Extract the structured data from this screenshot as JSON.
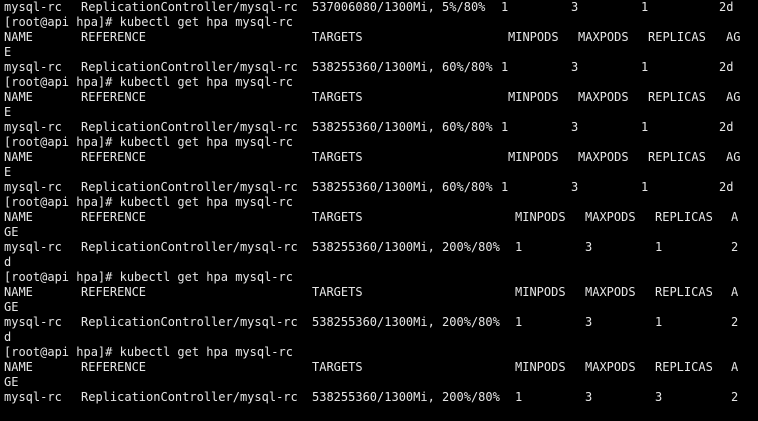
{
  "terminal": {
    "background": "#000000",
    "foreground": "#e6e6e6",
    "lines": [
      {
        "kind": "row",
        "cells": [
          "mysql-rc",
          "ReplicationController/mysql-rc",
          "537006080/1300Mi, 5%/80%",
          "1",
          "3",
          "1",
          "2d"
        ]
      },
      {
        "kind": "text",
        "text": "[root@api hpa]# kubectl get hpa mysql-rc"
      },
      {
        "kind": "header",
        "cells": [
          "NAME",
          "REFERENCE",
          "TARGETS",
          "MINPODS",
          "MAXPODS",
          "REPLICAS",
          "AG"
        ]
      },
      {
        "kind": "text",
        "text": "E"
      },
      {
        "kind": "row",
        "cells": [
          "mysql-rc",
          "ReplicationController/mysql-rc",
          "538255360/1300Mi, 60%/80%",
          "1",
          "3",
          "1",
          "2d"
        ]
      },
      {
        "kind": "text",
        "text": "[root@api hpa]# kubectl get hpa mysql-rc"
      },
      {
        "kind": "header",
        "cells": [
          "NAME",
          "REFERENCE",
          "TARGETS",
          "MINPODS",
          "MAXPODS",
          "REPLICAS",
          "AG"
        ]
      },
      {
        "kind": "text",
        "text": "E"
      },
      {
        "kind": "row",
        "cells": [
          "mysql-rc",
          "ReplicationController/mysql-rc",
          "538255360/1300Mi, 60%/80%",
          "1",
          "3",
          "1",
          "2d"
        ]
      },
      {
        "kind": "text",
        "text": "[root@api hpa]# kubectl get hpa mysql-rc"
      },
      {
        "kind": "header",
        "cells": [
          "NAME",
          "REFERENCE",
          "TARGETS",
          "MINPODS",
          "MAXPODS",
          "REPLICAS",
          "AG"
        ]
      },
      {
        "kind": "text",
        "text": "E"
      },
      {
        "kind": "row",
        "cells": [
          "mysql-rc",
          "ReplicationController/mysql-rc",
          "538255360/1300Mi, 60%/80%",
          "1",
          "3",
          "1",
          "2d"
        ]
      },
      {
        "kind": "text",
        "text": "[root@api hpa]# kubectl get hpa mysql-rc"
      },
      {
        "kind": "header2",
        "cells": [
          "NAME",
          "REFERENCE",
          "TARGETS",
          "MINPODS",
          "MAXPODS",
          "REPLICAS",
          "A"
        ]
      },
      {
        "kind": "text",
        "text": "GE"
      },
      {
        "kind": "row2",
        "cells": [
          "mysql-rc",
          "ReplicationController/mysql-rc",
          "538255360/1300Mi, 200%/80%",
          "1",
          "3",
          "1",
          "2"
        ]
      },
      {
        "kind": "text",
        "text": "d"
      },
      {
        "kind": "text",
        "text": "[root@api hpa]# kubectl get hpa mysql-rc"
      },
      {
        "kind": "header2",
        "cells": [
          "NAME",
          "REFERENCE",
          "TARGETS",
          "MINPODS",
          "MAXPODS",
          "REPLICAS",
          "A"
        ]
      },
      {
        "kind": "text",
        "text": "GE"
      },
      {
        "kind": "row2",
        "cells": [
          "mysql-rc",
          "ReplicationController/mysql-rc",
          "538255360/1300Mi, 200%/80%",
          "1",
          "3",
          "1",
          "2"
        ]
      },
      {
        "kind": "text",
        "text": "d"
      },
      {
        "kind": "text",
        "text": "[root@api hpa]# kubectl get hpa mysql-rc"
      },
      {
        "kind": "header2",
        "cells": [
          "NAME",
          "REFERENCE",
          "TARGETS",
          "MINPODS",
          "MAXPODS",
          "REPLICAS",
          "A"
        ]
      },
      {
        "kind": "text",
        "text": "GE"
      },
      {
        "kind": "row2",
        "cells": [
          "mysql-rc",
          "ReplicationController/mysql-rc",
          "538255360/1300Mi, 200%/80%",
          "1",
          "3",
          "3",
          "2"
        ]
      }
    ]
  }
}
